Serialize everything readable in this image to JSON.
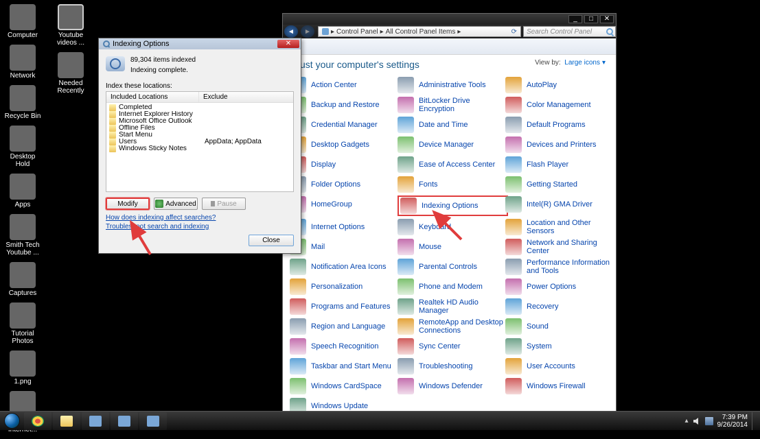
{
  "desktop_icons_col1": [
    {
      "name": "Computer",
      "g": "g-computer"
    },
    {
      "name": "Network",
      "g": "g-net"
    },
    {
      "name": "Recycle Bin",
      "g": "g-bin"
    },
    {
      "name": "Desktop Hold",
      "g": "g-folder"
    },
    {
      "name": "Apps",
      "g": "g-folder"
    },
    {
      "name": "Smith Tech Youtube ...",
      "g": "g-folder"
    },
    {
      "name": "Captures",
      "g": "g-folder"
    },
    {
      "name": "Tutorial Photos",
      "g": "g-folder"
    },
    {
      "name": "1.png",
      "g": "g-folder"
    },
    {
      "name": "Kaspersky Internet...",
      "g": "g-k"
    }
  ],
  "desktop_icons_col2": [
    {
      "name": "Youtube videos ...",
      "g": "g-yt"
    },
    {
      "name": "Needed Recently",
      "g": "g-recent"
    }
  ],
  "taskbar": {
    "time": "7:39 PM",
    "date": "9/26/2014"
  },
  "control_panel": {
    "breadcrumb": [
      "Control Panel",
      "All Control Panel Items"
    ],
    "search_placeholder": "Search Control Panel",
    "heading": "ust your computer's settings",
    "view_by_label": "View by:",
    "view_by_value": "Large icons",
    "items": [
      "Action Center",
      "Administrative Tools",
      "AutoPlay",
      "Backup and Restore",
      "BitLocker Drive Encryption",
      "Color Management",
      "Credential Manager",
      "Date and Time",
      "Default Programs",
      "Desktop Gadgets",
      "Device Manager",
      "Devices and Printers",
      "Display",
      "Ease of Access Center",
      "Flash Player",
      "Folder Options",
      "Fonts",
      "Getting Started",
      "HomeGroup",
      "Indexing Options",
      "Intel(R) GMA Driver",
      "Internet Options",
      "Keyboard",
      "Location and Other Sensors",
      "Mail",
      "Mouse",
      "Network and Sharing Center",
      "Notification Area Icons",
      "Parental Controls",
      "Performance Information and Tools",
      "Personalization",
      "Phone and Modem",
      "Power Options",
      "Programs and Features",
      "Realtek HD Audio Manager",
      "Recovery",
      "Region and Language",
      "RemoteApp and Desktop Connections",
      "Sound",
      "Speech Recognition",
      "Sync Center",
      "System",
      "Taskbar and Start Menu",
      "Troubleshooting",
      "User Accounts",
      "Windows CardSpace",
      "Windows Defender",
      "Windows Firewall",
      "Windows Update"
    ],
    "highlight_index": 19
  },
  "indexing": {
    "title": "Indexing Options",
    "count_line": "89,304 items indexed",
    "status": "Indexing complete.",
    "locations_label": "Index these locations:",
    "col_included": "Included Locations",
    "col_exclude": "Exclude",
    "rows": [
      {
        "name": "Completed",
        "excl": ""
      },
      {
        "name": "Internet Explorer History",
        "excl": ""
      },
      {
        "name": "Microsoft Office Outlook",
        "excl": ""
      },
      {
        "name": "Offline Files",
        "excl": ""
      },
      {
        "name": "Start Menu",
        "excl": ""
      },
      {
        "name": "Users",
        "excl": "AppData; AppData"
      },
      {
        "name": "Windows Sticky Notes",
        "excl": ""
      }
    ],
    "btn_modify": "Modify",
    "btn_advanced": "Advanced",
    "btn_pause": "Pause",
    "link1": "How does indexing affect searches?",
    "link2": "Troubleshoot search and indexing",
    "btn_close": "Close"
  }
}
